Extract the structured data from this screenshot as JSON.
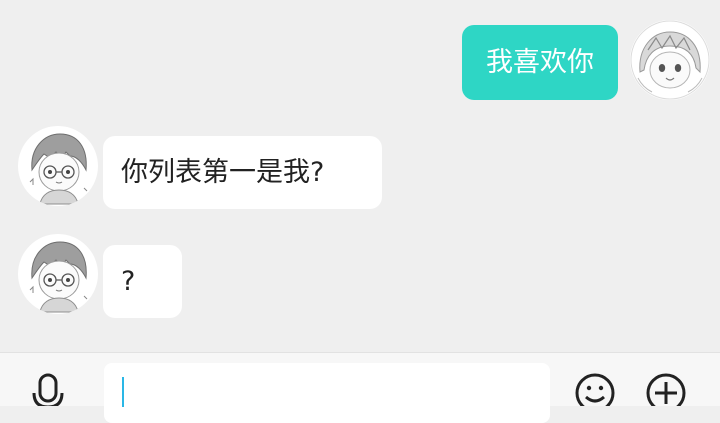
{
  "messages": [
    {
      "side": "outgoing",
      "text": "我喜欢你"
    },
    {
      "side": "incoming",
      "text": "你列表第一是我?"
    },
    {
      "side": "incoming",
      "text": "?"
    }
  ],
  "input": {
    "value": ""
  },
  "icons": {
    "voice": "microphone-icon",
    "emoji": "emoji-icon",
    "more": "plus-icon"
  },
  "colors": {
    "outgoing_bubble": "#2ed6c5",
    "incoming_bubble": "#ffffff",
    "background": "#efefef"
  }
}
